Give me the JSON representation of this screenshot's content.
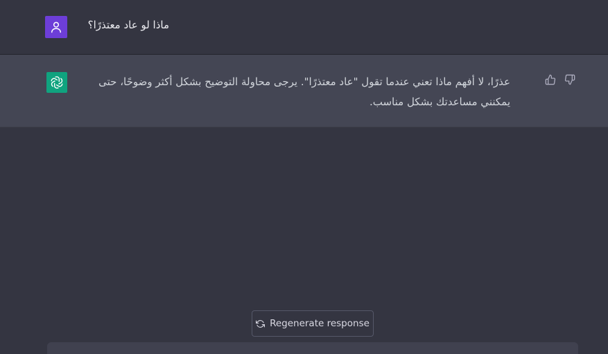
{
  "conversation": {
    "user_message": "ماذا لو عاد معتذرًا؟",
    "assistant_message": "عذرًا، لا أفهم ماذا تعني عندما تقول \"عاد معتذرًا\". يرجى محاولة التوضيح بشكل أكثر وضوحًا، حتى يمكنني مساعدتك بشكل مناسب."
  },
  "actions": {
    "regenerate_label": "Regenerate response"
  },
  "icons": {
    "user_avatar": "user-icon",
    "assistant_avatar": "openai-logo-icon",
    "thumbs_up": "thumbs-up-icon",
    "thumbs_down": "thumbs-down-icon",
    "regenerate": "refresh-icon"
  },
  "colors": {
    "background": "#343541",
    "assistant_row": "#444654",
    "user_avatar": "#6d3ed8",
    "assistant_avatar": "#10a37f",
    "composer": "#40414f"
  }
}
